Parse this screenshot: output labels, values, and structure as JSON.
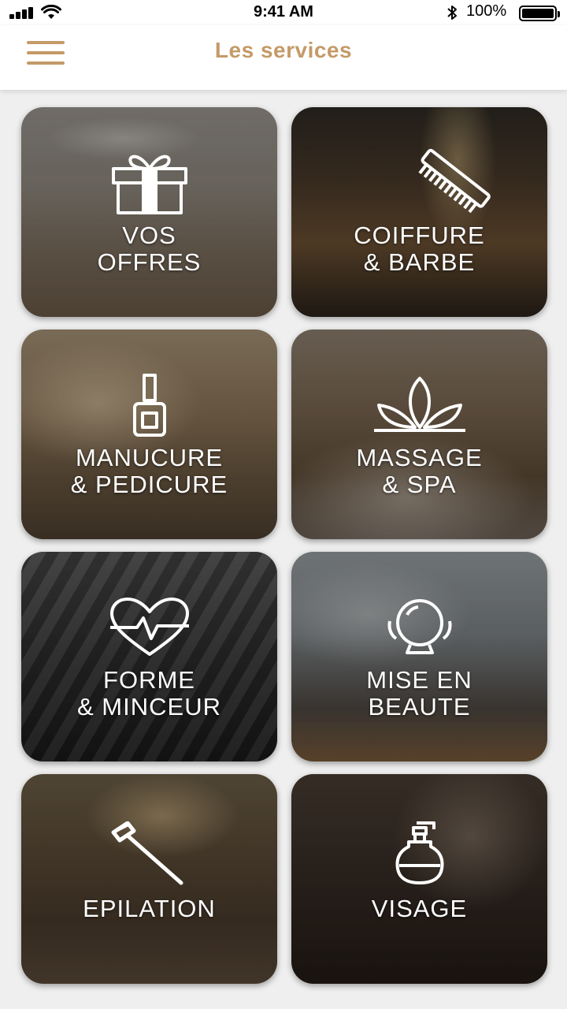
{
  "status_bar": {
    "time": "9:41 AM",
    "battery": "100%",
    "icons": [
      "signal-icon",
      "wifi-icon",
      "bluetooth-icon",
      "battery-icon"
    ]
  },
  "header": {
    "title": "Les services",
    "menu_icon": "hamburger-menu-icon"
  },
  "colors": {
    "accent": "#c49a68",
    "background": "#efefef",
    "card_text": "#ffffff"
  },
  "services": [
    {
      "line1": "VOS",
      "line2": "OFFRES",
      "icon": "gift-icon"
    },
    {
      "line1": "COIFFURE",
      "line2": "& BARBE",
      "icon": "comb-icon"
    },
    {
      "line1": "MANUCURE",
      "line2": "& PEDICURE",
      "icon": "nail-polish-icon"
    },
    {
      "line1": "MASSAGE",
      "line2": "& SPA",
      "icon": "lotus-icon"
    },
    {
      "line1": "FORME",
      "line2": "& MINCEUR",
      "icon": "heart-pulse-icon"
    },
    {
      "line1": "MISE EN",
      "line2": "BEAUTE",
      "icon": "mirror-icon"
    },
    {
      "line1": "EPILATION",
      "line2": "",
      "icon": "razor-icon"
    },
    {
      "line1": "VISAGE",
      "line2": "",
      "icon": "pump-bottle-icon"
    }
  ]
}
